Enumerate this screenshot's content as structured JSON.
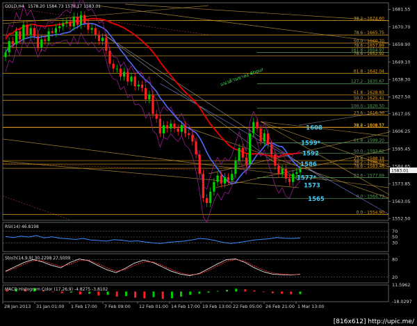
{
  "header": {
    "symbol_tf": "GOLD,H4",
    "ohlc": "1578.20 1584.73 1578.17 1583.01"
  },
  "watermark": "[816x612] http://upic.me/",
  "colors": {
    "background": "#000000",
    "bull": "#00d000",
    "bear": "#ff2020",
    "ma_slow": "#e00000",
    "ma_fast": "#4e6cff",
    "envelope": "#9a1c8e",
    "fib_gold": "#e0a020",
    "fib_green": "#5fa05f",
    "label_cyan": "#49c8f0"
  },
  "chart_data": [
    {
      "type": "line",
      "title": "GOLD,H4",
      "chart_kind": "candlestick",
      "ylim": [
        1551.3,
        1685.6
      ],
      "price_ticks": [
        "1681.55",
        "1670.70",
        "1659.90",
        "1649.10",
        "1638.30",
        "1627.50",
        "1617.05",
        "1606.25",
        "1595.45",
        "1584.65",
        "1573.85",
        "1563.05",
        "1552.50"
      ],
      "current_price": "1583.01",
      "x_ticks": [
        "28 Jan 2013",
        "31 Jan 01:00",
        "1 Feb 17:00",
        "7 Feb 09:00",
        "12 Feb 01:00",
        "14 Feb 17:00",
        "19 Feb 13:00",
        "22 Feb 05:00",
        "26 Feb 21:00",
        "1 Mar 13:00"
      ],
      "close_series": [
        1655,
        1662,
        1660,
        1668,
        1663,
        1672,
        1666,
        1670,
        1665,
        1658,
        1663,
        1662,
        1668,
        1667,
        1670,
        1671,
        1673,
        1674,
        1671,
        1677,
        1672,
        1678,
        1673,
        1669,
        1670,
        1666,
        1662,
        1664,
        1656,
        1648,
        1645,
        1645,
        1640,
        1643,
        1637,
        1640,
        1634,
        1635,
        1633,
        1626,
        1629,
        1617,
        1614,
        1605,
        1610,
        1608,
        1611,
        1608,
        1606,
        1610,
        1605,
        1604,
        1600,
        1592,
        1580,
        1565,
        1562,
        1569,
        1575,
        1579,
        1574,
        1578,
        1576,
        1580,
        1588,
        1596,
        1590,
        1586,
        1605,
        1612,
        1608,
        1600,
        1605,
        1598,
        1592,
        1585,
        1580,
        1583,
        1577,
        1575,
        1580,
        1581,
        1583
      ],
      "fib_levels": [
        {
          "label": "38.2 - 1674.60",
          "price": 1674.6
        },
        {
          "label": "78.6 - 1665.75",
          "price": 1665.75
        },
        {
          "label": "50.0 - 1660.70",
          "price": 1660.7
        },
        {
          "label": "78.6 - 1657.89",
          "price": 1657.89
        },
        {
          "label": "161.8 - 1654.97",
          "price": 1654.97
        },
        {
          "label": "78.6 - 1652.92",
          "price": 1652.92
        },
        {
          "label": "61.8 - 1642.04",
          "price": 1642.04
        },
        {
          "label": "127.2 - 1635.67",
          "price": 1635.67
        },
        {
          "label": "61.8 - 1628.83",
          "price": 1628.83
        },
        {
          "label": "50.0 - 1625.41",
          "price": 1625.41
        },
        {
          "label": "100.0 - 1620.50",
          "price": 1620.5
        },
        {
          "label": "23.6 - 1616.30",
          "price": 1616.3
        },
        {
          "label": "78.6 - 1608.57",
          "price": 1608.57
        },
        {
          "label": "38.2 - 1608.77",
          "price": 1608.77
        },
        {
          "label": "61.8 - 1599.20",
          "price": 1599.2
        },
        {
          "label": "50.0 - 1592.62",
          "price": 1592.62
        },
        {
          "label": "23.6 - 1588.18",
          "price": 1588.18
        },
        {
          "label": "38.2 - 1586.03",
          "price": 1586.03
        },
        {
          "label": "78.6 - 1583.46",
          "price": 1583.46
        },
        {
          "label": "23.6 - 1577.69",
          "price": 1577.69
        },
        {
          "label": "0.0 - 1564.73",
          "price": 1564.73
        },
        {
          "label": "0.0 - 1554.90",
          "price": 1554.9
        }
      ],
      "level_labels": [
        "1608",
        "1599*",
        "1592",
        "1586",
        "1577*",
        "1573",
        "1565"
      ],
      "annotation": "แนวต้านขาลง 4hour"
    },
    {
      "type": "line",
      "title": "RSI(14) 46.8198",
      "ylim": [
        0,
        100
      ],
      "levels": [
        "70",
        "50",
        "30"
      ],
      "values": [
        52,
        48,
        53,
        50,
        55,
        47,
        51,
        46,
        44,
        42,
        45,
        40,
        38,
        36,
        41,
        39,
        35,
        37,
        33,
        30,
        28,
        32,
        34,
        36,
        40,
        45,
        43,
        38,
        32,
        28,
        31,
        35,
        40,
        42,
        44,
        48,
        46,
        45,
        47
      ]
    },
    {
      "type": "line",
      "title": "Stoch(14,9,9) 30.2298 27.5009",
      "ylim": [
        0,
        100
      ],
      "levels": [
        "80",
        "20"
      ],
      "series": [
        {
          "values": [
            40,
            55,
            70,
            80,
            72,
            60,
            52,
            70,
            82,
            76,
            60,
            45,
            35,
            50,
            68,
            78,
            70,
            55,
            40,
            30,
            25,
            32,
            48,
            65,
            80,
            82,
            70,
            52,
            38,
            30,
            28,
            27,
            30
          ]
        },
        {
          "values": [
            38,
            50,
            64,
            76,
            76,
            66,
            56,
            64,
            76,
            78,
            66,
            52,
            40,
            46,
            60,
            72,
            72,
            60,
            46,
            34,
            28,
            30,
            42,
            58,
            74,
            80,
            74,
            58,
            44,
            34,
            30,
            28,
            29
          ]
        }
      ]
    },
    {
      "type": "bar",
      "title": "MACD Histogram Color (17,26,9) -4.8275 -3.8102",
      "ylim": [
        -18.0297,
        11.5962
      ],
      "ticks": [
        "11.5962",
        "-18.0297"
      ],
      "values": [
        3,
        5,
        4,
        6,
        2,
        -1,
        -3,
        -2,
        -5,
        -4,
        -7,
        -6,
        -9,
        -8,
        -11,
        -12,
        -10,
        -13,
        -12,
        -9,
        -6,
        -4,
        -2,
        1,
        3,
        5,
        4,
        2,
        -1,
        -3,
        -4,
        -5,
        -4.8
      ]
    }
  ]
}
